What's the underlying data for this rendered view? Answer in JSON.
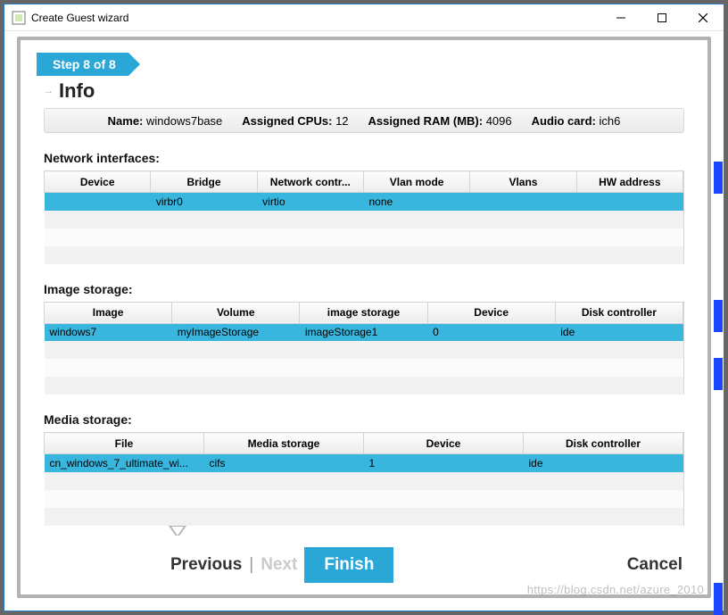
{
  "window": {
    "title": "Create Guest wizard"
  },
  "step": {
    "label": "Step 8 of 8"
  },
  "info": {
    "title": "Info"
  },
  "summary": {
    "name_label": "Name:",
    "name_value": "windows7base",
    "cpu_label": "Assigned CPUs:",
    "cpu_value": "12",
    "ram_label": "Assigned RAM (MB):",
    "ram_value": "4096",
    "audio_label": "Audio card:",
    "audio_value": "ich6"
  },
  "sections": {
    "network": {
      "title": "Network interfaces:",
      "headers": [
        "Device",
        "Bridge",
        "Network contr...",
        "Vlan mode",
        "Vlans",
        "HW address"
      ],
      "rows": [
        {
          "device": "",
          "bridge": "virbr0",
          "controller": "virtio",
          "vlan_mode": "none",
          "vlans": "",
          "hw": ""
        }
      ]
    },
    "image": {
      "title": "Image storage:",
      "headers": [
        "Image",
        "Volume",
        "image storage",
        "Device",
        "Disk controller"
      ],
      "rows": [
        {
          "image": "windows7",
          "volume": "myImageStorage",
          "storage": "imageStorage1",
          "device": "0",
          "controller": "ide"
        }
      ]
    },
    "media": {
      "title": "Media storage:",
      "headers": [
        "File",
        "Media storage",
        "Device",
        "Disk controller"
      ],
      "rows": [
        {
          "file": "cn_windows_7_ultimate_wi...",
          "storage": "cifs",
          "device": "1",
          "controller": "ide"
        }
      ]
    }
  },
  "footer": {
    "previous": "Previous",
    "next": "Next",
    "finish": "Finish",
    "cancel": "Cancel"
  },
  "watermark": "https://blog.csdn.net/azure_2010"
}
